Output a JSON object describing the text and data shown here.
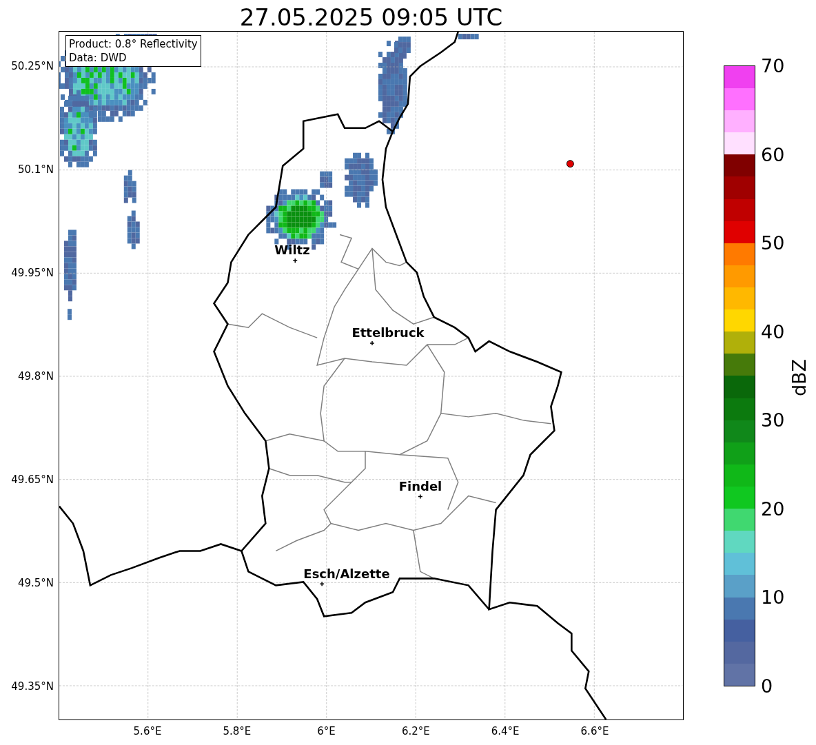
{
  "title": "27.05.2025 09:05 UTC",
  "info_box": [
    "Product: 0.8° Reflectivity",
    "Data: DWD"
  ],
  "lat_labels": [
    "50.25°N",
    "50.1°N",
    "49.95°N",
    "49.8°N",
    "49.65°N",
    "49.5°N",
    "49.35°N"
  ],
  "lon_labels": [
    "5.6°E",
    "5.8°E",
    "6°E",
    "6.2°E",
    "6.4°E",
    "6.6°E"
  ],
  "cities": [
    {
      "name": "Wiltz"
    },
    {
      "name": "Ettelbruck"
    },
    {
      "name": "Findel"
    },
    {
      "name": "Esch/Alzette"
    }
  ],
  "colorbar": {
    "label": "dBZ",
    "ticks": [
      "70",
      "60",
      "50",
      "40",
      "30",
      "20",
      "10",
      "0"
    ],
    "segments": [
      {
        "color": "#6173a6"
      },
      {
        "color": "#5468a0"
      },
      {
        "color": "#4560a0"
      },
      {
        "color": "#4a78b0"
      },
      {
        "color": "#5aa0c8"
      },
      {
        "color": "#60c0d8"
      },
      {
        "color": "#60d8c0"
      },
      {
        "color": "#40d870"
      },
      {
        "color": "#10c820"
      },
      {
        "color": "#10b818"
      },
      {
        "color": "#10a018"
      },
      {
        "color": "#10881a"
      },
      {
        "color": "#0c7a0e"
      },
      {
        "color": "#0a680a"
      },
      {
        "color": "#467a0a"
      },
      {
        "color": "#b0b00a"
      },
      {
        "color": "#ffd700"
      },
      {
        "color": "#ffb800"
      },
      {
        "color": "#ff9a00"
      },
      {
        "color": "#ff7a00"
      },
      {
        "color": "#e00000"
      },
      {
        "color": "#c00000"
      },
      {
        "color": "#a00000"
      },
      {
        "color": "#800000"
      },
      {
        "color": "#ffe0ff"
      },
      {
        "color": "#ffb0ff"
      },
      {
        "color": "#ff70ff"
      },
      {
        "color": "#f040f0"
      }
    ]
  }
}
